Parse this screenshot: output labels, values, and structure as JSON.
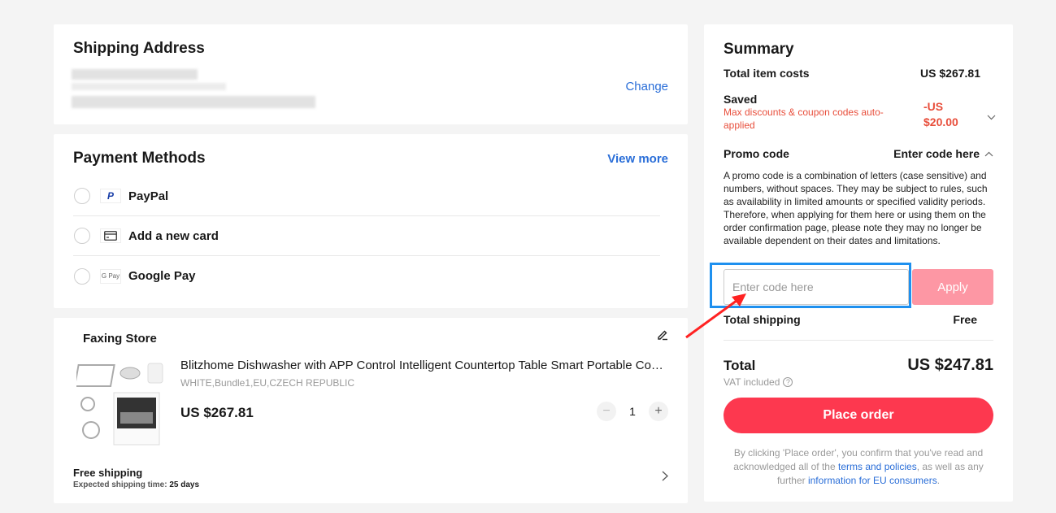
{
  "shipping": {
    "title": "Shipping Address",
    "change_label": "Change"
  },
  "payment": {
    "title": "Payment Methods",
    "view_more_label": "View more",
    "methods": [
      {
        "label": "PayPal",
        "icon": "paypal-icon"
      },
      {
        "label": "Add a new card",
        "icon": "credit-card-icon"
      },
      {
        "label": "Google Pay",
        "icon": "google-pay-icon"
      }
    ],
    "gpay_glyph": "G Pay",
    "paypal_glyph": "P"
  },
  "store": {
    "name": "Faxing Store",
    "product": {
      "title": "Blitzhome Dishwasher with APP Control Intelligent Countertop Table Smart Portable Countertop Dishwasher",
      "sku": "WHITE,Bundle1,EU,CZECH REPUBLIC",
      "price": "US $267.81",
      "quantity": "1"
    },
    "free_shipping": "Free shipping",
    "shipping_time_label": "Expected shipping time:",
    "shipping_time_value": "25 days"
  },
  "summary": {
    "title": "Summary",
    "total_item_costs_label": "Total item costs",
    "total_item_costs_value": "US $267.81",
    "saved_label": "Saved",
    "saved_sub": "Max discounts & coupon codes auto-applied",
    "saved_value": "-US $20.00",
    "promo_label": "Promo code",
    "promo_toggle": "Enter code here",
    "promo_text": "A promo code is a combination of letters (case sensitive) and numbers, without spaces. They may be subject to rules, such as availability in limited amounts or specified validity periods. Therefore, when applying for them here or using them on the order confirmation page, please note they may no longer be available dependent on their dates and limitations.",
    "promo_placeholder": "Enter code here",
    "apply_label": "Apply",
    "shipping_label": "Total shipping",
    "shipping_value": "Free",
    "total_label": "Total",
    "total_value": "US $247.81",
    "vat_label": "VAT included",
    "place_order_label": "Place order",
    "legal_pre": "By clicking 'Place order', you confirm that you've read and acknowledged all of the ",
    "legal_link1": "terms and policies",
    "legal_mid": ", as well as any further ",
    "legal_link2": "information for EU consumers",
    "legal_post": "."
  },
  "colors": {
    "accent_red": "#fd384f",
    "apply_disabled": "#fd97a4",
    "link_blue": "#2a6ed8",
    "saved_red": "#e84e3b",
    "focus_blue": "#1e90ef"
  }
}
